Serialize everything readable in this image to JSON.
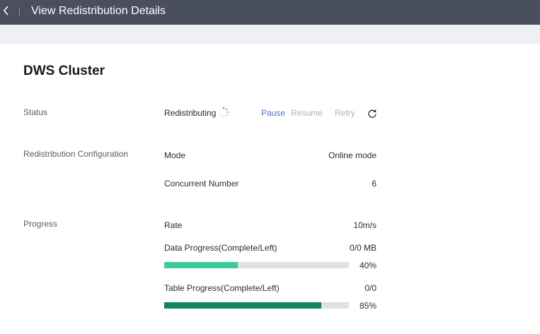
{
  "header": {
    "title": "View Redistribution Details"
  },
  "section": {
    "title": "DWS Cluster"
  },
  "status": {
    "label": "Status",
    "value": "Redistributing",
    "actions": {
      "pause": "Pause",
      "resume": "Resume",
      "retry": "Retry"
    }
  },
  "config": {
    "label": "Redistribution Configuration",
    "mode_label": "Mode",
    "mode_value": "Online mode",
    "concurrent_label": "Concurrent Number",
    "concurrent_value": "6"
  },
  "progress": {
    "label": "Progress",
    "rate_label": "Rate",
    "rate_value": "10m/s",
    "data": {
      "label": "Data Progress(Complete/Left)",
      "value": "0/0 MB",
      "percent_text": "40%",
      "percent": 40,
      "color": "#3ec9a0"
    },
    "table": {
      "label": "Table Progress(Complete/Left)",
      "value": "0/0",
      "percent_text": "85%",
      "percent": 85,
      "color": "#0f8560"
    }
  }
}
